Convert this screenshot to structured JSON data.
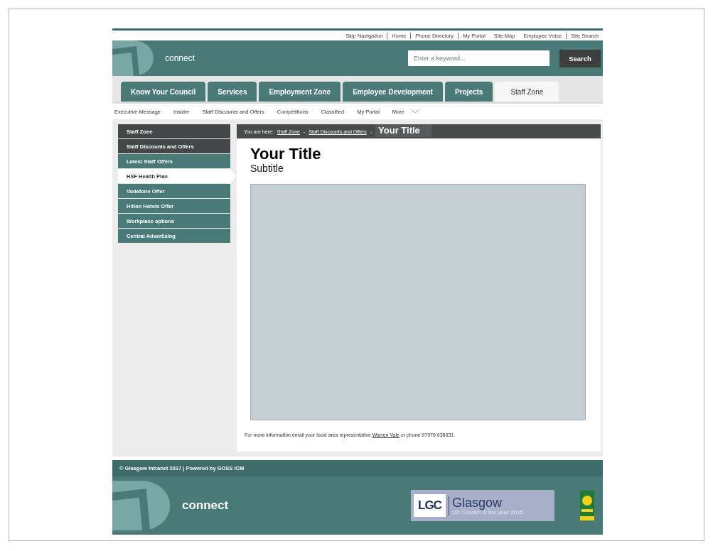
{
  "utility_links": [
    "Skip Navigation",
    "Home",
    "Phone Directory",
    "My Portal",
    "Site Map",
    "Employee Voice",
    "Site Search"
  ],
  "header": {
    "site_name": "connect",
    "search": {
      "placeholder": "Enter a keyword..."
    },
    "search_button": "Search"
  },
  "tabs": [
    {
      "label": "Know Your Council",
      "selected": false
    },
    {
      "label": "Services",
      "selected": false
    },
    {
      "label": "Employment Zone",
      "selected": false
    },
    {
      "label": "Employee Development",
      "selected": false
    },
    {
      "label": "Projects",
      "selected": false
    },
    {
      "label": "Staff Zone",
      "selected": true
    }
  ],
  "subnav": {
    "items": [
      "Executive Message",
      "Insider",
      "Staff Discounts and Offers",
      "Competitions",
      "Classified",
      "My Portal"
    ],
    "more": "More"
  },
  "sidebar": {
    "items": [
      {
        "label": "Staff Zone",
        "kind": "parent",
        "selected": false
      },
      {
        "label": "Staff Discounts and Offers",
        "kind": "parent",
        "selected": false
      },
      {
        "label": "Latest Staff Offers",
        "kind": "child",
        "selected": false
      },
      {
        "label": "HSF Health Plan",
        "kind": "child",
        "selected": true
      },
      {
        "label": "Vodafone Offer",
        "kind": "child",
        "selected": false
      },
      {
        "label": "Hilton Hotels Offer",
        "kind": "child",
        "selected": false
      },
      {
        "label": "Workplace options",
        "kind": "child",
        "selected": false
      },
      {
        "label": "Central Advertising",
        "kind": "child",
        "selected": false
      }
    ]
  },
  "breadcrumb": {
    "prefix": "You are here:",
    "links": [
      "Staff Zone",
      "Staff Discounts and Offers"
    ],
    "separator": "-",
    "current": "Your Title"
  },
  "content": {
    "title": "Your Title",
    "subtitle": "Subtitle",
    "image": {
      "kind": "placeholder"
    },
    "info_before": "For more information email your local area representative",
    "info_link": "Warren Vale",
    "info_after": "or phone 07976 638031."
  },
  "footer": {
    "copyright": "© Glasgow Intranet 2017 | Powered by GOSS ICM",
    "site_name": "connect",
    "award": {
      "badge": "LGC",
      "city": "Glasgow",
      "caption": "UK Council of the year 2015"
    }
  }
}
